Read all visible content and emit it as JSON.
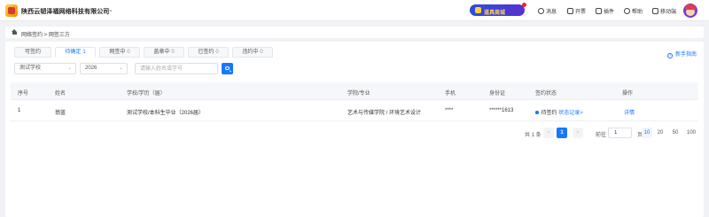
{
  "header": {
    "org_name": "陕西云韧泽福网络科技有限公司",
    "mall_label": "道具商城",
    "links": [
      {
        "label": "消息",
        "icon": "bell-icon"
      },
      {
        "label": "开票",
        "icon": "invoice-icon"
      },
      {
        "label": "插件",
        "icon": "plugin-icon"
      },
      {
        "label": "帮助",
        "icon": "help-icon"
      },
      {
        "label": "移动端",
        "icon": "qrcode-icon"
      }
    ]
  },
  "breadcrumb": "网络签约 > 网签三方",
  "tabs": [
    {
      "label": "可签约",
      "count": ""
    },
    {
      "label": "待确定",
      "count": "1"
    },
    {
      "label": "网签中",
      "count": "0"
    },
    {
      "label": "盖章中",
      "count": "0"
    },
    {
      "label": "已签约",
      "count": "0"
    },
    {
      "label": "违约中",
      "count": "0"
    }
  ],
  "help_link": "新手指南",
  "filters": {
    "school": "测试学校",
    "year": "2026",
    "search_placeholder": "请输入姓名或学号"
  },
  "table": {
    "columns": [
      "序号",
      "姓名",
      "学校/学历（届）",
      "学院/专业",
      "手机",
      "身份证",
      "签约状态",
      "操作"
    ],
    "rows": [
      {
        "index": "1",
        "name": "翁蓝",
        "school": "测试学校/本科生毕业（2026届）",
        "major": "艺术与传媒学院 / 环境艺术设计",
        "phone": "****",
        "id_card": "******1613",
        "status": "待签约",
        "status_link": "状态记录>",
        "action": "详情"
      }
    ]
  },
  "pagination": {
    "total": "共 1 条",
    "prev": "<",
    "current": "1",
    "next": ">",
    "goto_label": "前往",
    "goto_value": "1",
    "page_unit": "页",
    "sizes": [
      "10",
      "20",
      "50",
      "100"
    ],
    "active_size": "10"
  },
  "colors": {
    "accent": "#1677ff",
    "mall_gradient_start": "#2b4fd8",
    "mall_gradient_end": "#5a2fd0"
  }
}
